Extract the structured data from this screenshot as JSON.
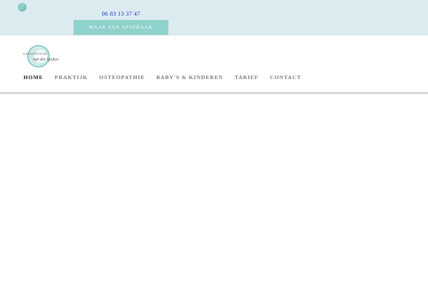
{
  "topbar": {
    "phone": "06 83 13 37 47",
    "appointment_label": "MAAK EEN AFSPRAAK"
  },
  "logo": {
    "line1": "OSTEOPATHIE",
    "line2": "van der Spijker"
  },
  "nav": {
    "items": [
      {
        "label": "HOME",
        "active": true
      },
      {
        "label": "PRAKTIJK",
        "active": false
      },
      {
        "label": "OSTEOPATHIE",
        "active": false
      },
      {
        "label": "BABY'S & KINDEREN",
        "active": false
      },
      {
        "label": "TARIEF",
        "active": false
      },
      {
        "label": "CONTACT",
        "active": false
      }
    ]
  },
  "colors": {
    "topbar_bg": "#dcebf0",
    "accent": "#8fd2cb",
    "link": "#1a3bc4"
  }
}
